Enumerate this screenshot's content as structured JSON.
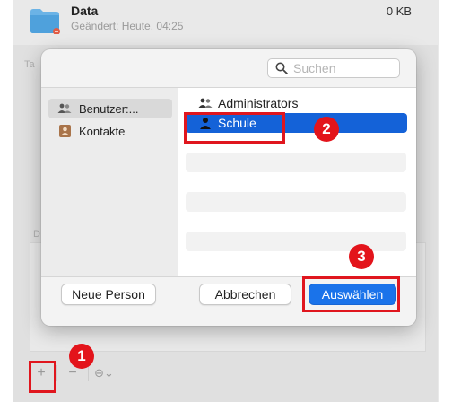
{
  "background_window": {
    "title": "Data",
    "subtitle": "Geändert: Heute, 04:25",
    "size": "0 KB",
    "fragment_ta": "Ta",
    "fragment_d": "D",
    "bottom": {
      "add_label": "+",
      "remove_label": "−",
      "action_label": "⊖⌄"
    }
  },
  "dialog": {
    "search_placeholder": "Suchen",
    "sources": [
      {
        "label": "Benutzer:...",
        "icon": "users-icon"
      },
      {
        "label": "Kontakte",
        "icon": "contacts-book-icon"
      }
    ],
    "list": [
      {
        "label": "Administrators",
        "icon": "users-icon",
        "selected": false
      },
      {
        "label": "Schule",
        "icon": "person-icon",
        "selected": true
      }
    ],
    "buttons": {
      "new_person": "Neue Person",
      "cancel": "Abbrechen",
      "select": "Auswählen"
    }
  },
  "annotations": {
    "badge_1": "1",
    "badge_2": "2",
    "badge_3": "3",
    "color": "#e0161e"
  },
  "colors": {
    "accent": "#1462d8",
    "primary_button": "#1a73ea"
  }
}
